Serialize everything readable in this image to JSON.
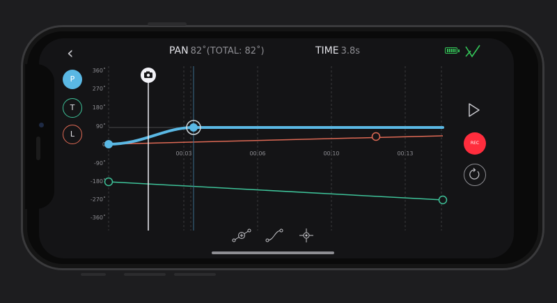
{
  "topbar": {
    "back_glyph": "‹",
    "pan_label": "PAN",
    "pan_value": "82˚(TOTAL: 82˚)",
    "time_label": "TIME",
    "time_value": "3.8s"
  },
  "axis_buttons": [
    {
      "label": "P",
      "color": "#5ab8e4"
    },
    {
      "label": "T",
      "color": "#3ec49a"
    },
    {
      "label": "L",
      "color": "#e06a55"
    }
  ],
  "rec_label": "REC",
  "y_ticks": [
    "360˚",
    "270˚",
    "180˚",
    "90˚",
    "0",
    "-90˚",
    "-180˚",
    "-270˚",
    "-360˚"
  ],
  "x_ticks": [
    "00:03",
    "00:06",
    "00:10",
    "00:13"
  ],
  "icons": {
    "back": "chevron-left-icon",
    "confirm": "checkmark-icon",
    "camera": "camera-icon",
    "play": "play-icon",
    "loop": "loop-icon",
    "add_keyframe": "add-keyframe-icon",
    "curve": "curve-icon",
    "target": "crosshair-icon"
  },
  "colors": {
    "pan": "#5ab8e4",
    "tilt": "#3ec49a",
    "slide": "#e06a55",
    "rec": "#ff2d3d",
    "battery": "#34c759"
  }
}
